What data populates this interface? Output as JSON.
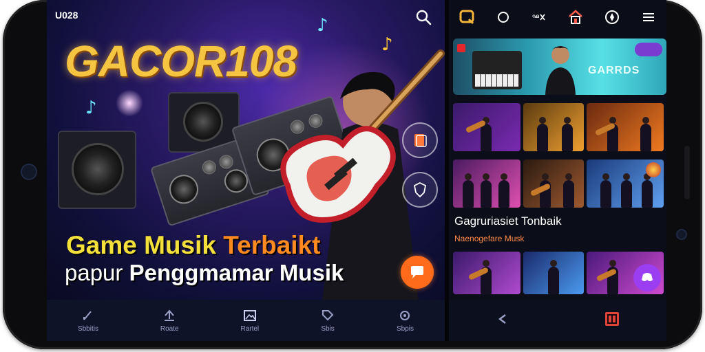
{
  "status_bar": {
    "time": "U028"
  },
  "promo": {
    "logo_text": "GACOR108",
    "headline_part1": "Game Musik ",
    "headline_part2": "Terbaikt",
    "subline_part1": "papur ",
    "subline_part2": "Penggmamar Musik"
  },
  "right_panel": {
    "banner_text": "GARRDS",
    "section_title": "Gagruriasiet Tonbaik",
    "section_subtitle": "Naenogefare Musk"
  },
  "bottom_nav": {
    "items": [
      {
        "label": "Sbbitis",
        "icon": "edit-icon"
      },
      {
        "label": "Roate",
        "icon": "upload-icon"
      },
      {
        "label": "Rartel",
        "icon": "image-icon"
      },
      {
        "label": "Sbis",
        "icon": "tag-icon"
      },
      {
        "label": "Sbpis",
        "icon": "settings-icon"
      }
    ]
  },
  "colors": {
    "logo_gold": "#f5c542",
    "headline_yellow": "#f4e03a",
    "accent_orange": "#ff8a1f",
    "chat_orange": "#ff6b1a",
    "fab_purple": "#9b3df0",
    "home_red": "#e0433a"
  }
}
